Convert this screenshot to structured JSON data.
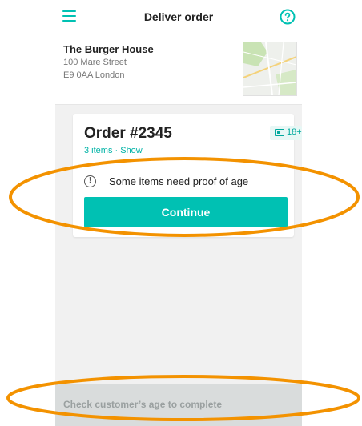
{
  "header": {
    "title": "Deliver order",
    "menu_icon": "hamburger-menu-icon",
    "help_icon": "help-circle-icon"
  },
  "restaurant": {
    "name": "The Burger House",
    "address_line1": "100 Mare Street",
    "address_line2": "E9 0AA London"
  },
  "order": {
    "title": "Order #2345",
    "items_link": "3 items · Show",
    "age_badge": "18+",
    "notice": "Some items need proof of age",
    "continue_label": "Continue"
  },
  "footer": {
    "status_text": "Check customer’s age to complete"
  },
  "colors": {
    "accent": "#00c1b3",
    "annotation": "#f39200",
    "footer_bg": "#d9dcdc"
  }
}
